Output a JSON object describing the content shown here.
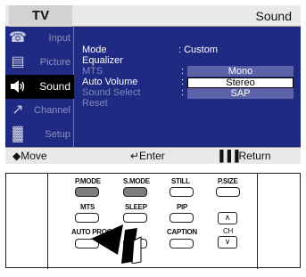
{
  "osd": {
    "source": "TV",
    "title": "Sound",
    "sidebar": [
      {
        "label": "Input",
        "icon": "input-icon",
        "glyph": "☎"
      },
      {
        "label": "Picture",
        "icon": "picture-icon",
        "glyph": "▤"
      },
      {
        "label": "Sound",
        "icon": "speaker-icon",
        "glyph": "◀"
      },
      {
        "label": "Channel",
        "icon": "antenna-icon",
        "glyph": "↗"
      },
      {
        "label": "Setup",
        "icon": "setup-icon",
        "glyph": "▓"
      }
    ],
    "menu": {
      "mode_label": "Mode",
      "mode_value": ": Custom",
      "equalizer": "Equalizer",
      "mts": "MTS",
      "auto_volume": "Auto Volume",
      "sound_select": "Sound Select",
      "reset": "Reset",
      "colon": ":",
      "options": [
        "Mono",
        "Stereo",
        "SAP"
      ],
      "selected_option": "Stereo"
    },
    "footer": {
      "move": "◆Move",
      "enter": "↵Enter",
      "return": "▐▐▐Return"
    },
    "colors": {
      "menu_bg": "#1f2a83",
      "header_bg": "#e9e9e9",
      "active_item_bg": "#000000"
    }
  },
  "remote": {
    "row1": [
      "P.MODE",
      "S.MODE",
      "STILL",
      "P.SIZE"
    ],
    "row2": [
      "MTS",
      "SLEEP",
      "PIP"
    ],
    "row3": [
      "AUTO PROG.",
      "CAPTION",
      "CH"
    ],
    "ch_up": "∧",
    "ch_down": "∨"
  }
}
